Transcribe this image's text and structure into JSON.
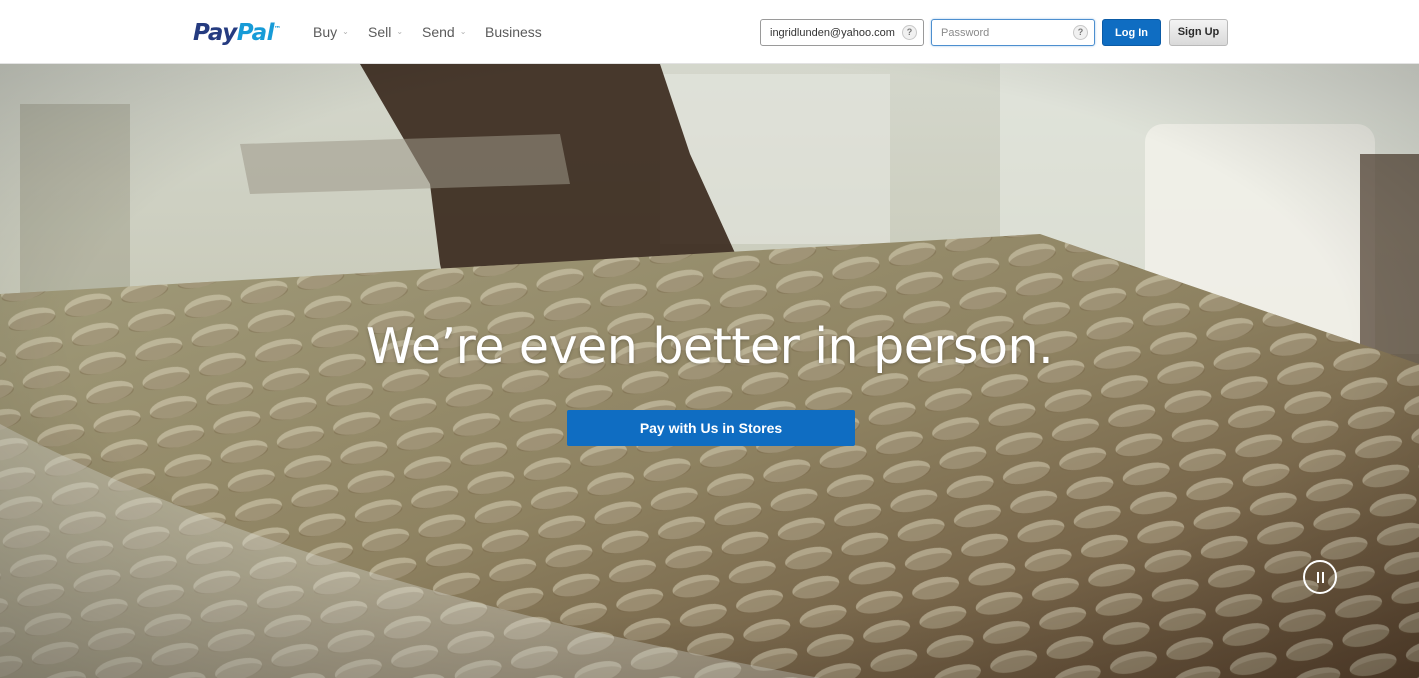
{
  "brand": {
    "name_part1": "Pay",
    "name_part2": "Pal",
    "trademark": "™"
  },
  "nav": {
    "items": [
      {
        "label": "Buy",
        "has_dropdown": true
      },
      {
        "label": "Sell",
        "has_dropdown": true
      },
      {
        "label": "Send",
        "has_dropdown": true
      },
      {
        "label": "Business",
        "has_dropdown": false
      }
    ],
    "caret": "⌄"
  },
  "login": {
    "email_value": "ingridlunden@yahoo.com",
    "email_help": "?",
    "password_placeholder": "Password",
    "password_help": "?",
    "login_label": "Log In",
    "signup_label": "Sign Up"
  },
  "hero": {
    "headline": "We’re even better in person.",
    "cta_label": "Pay with Us in Stores"
  },
  "colors": {
    "primary_blue": "#0f6dc2",
    "logo_dark_blue": "#253b80",
    "logo_light_blue": "#179bd7"
  }
}
